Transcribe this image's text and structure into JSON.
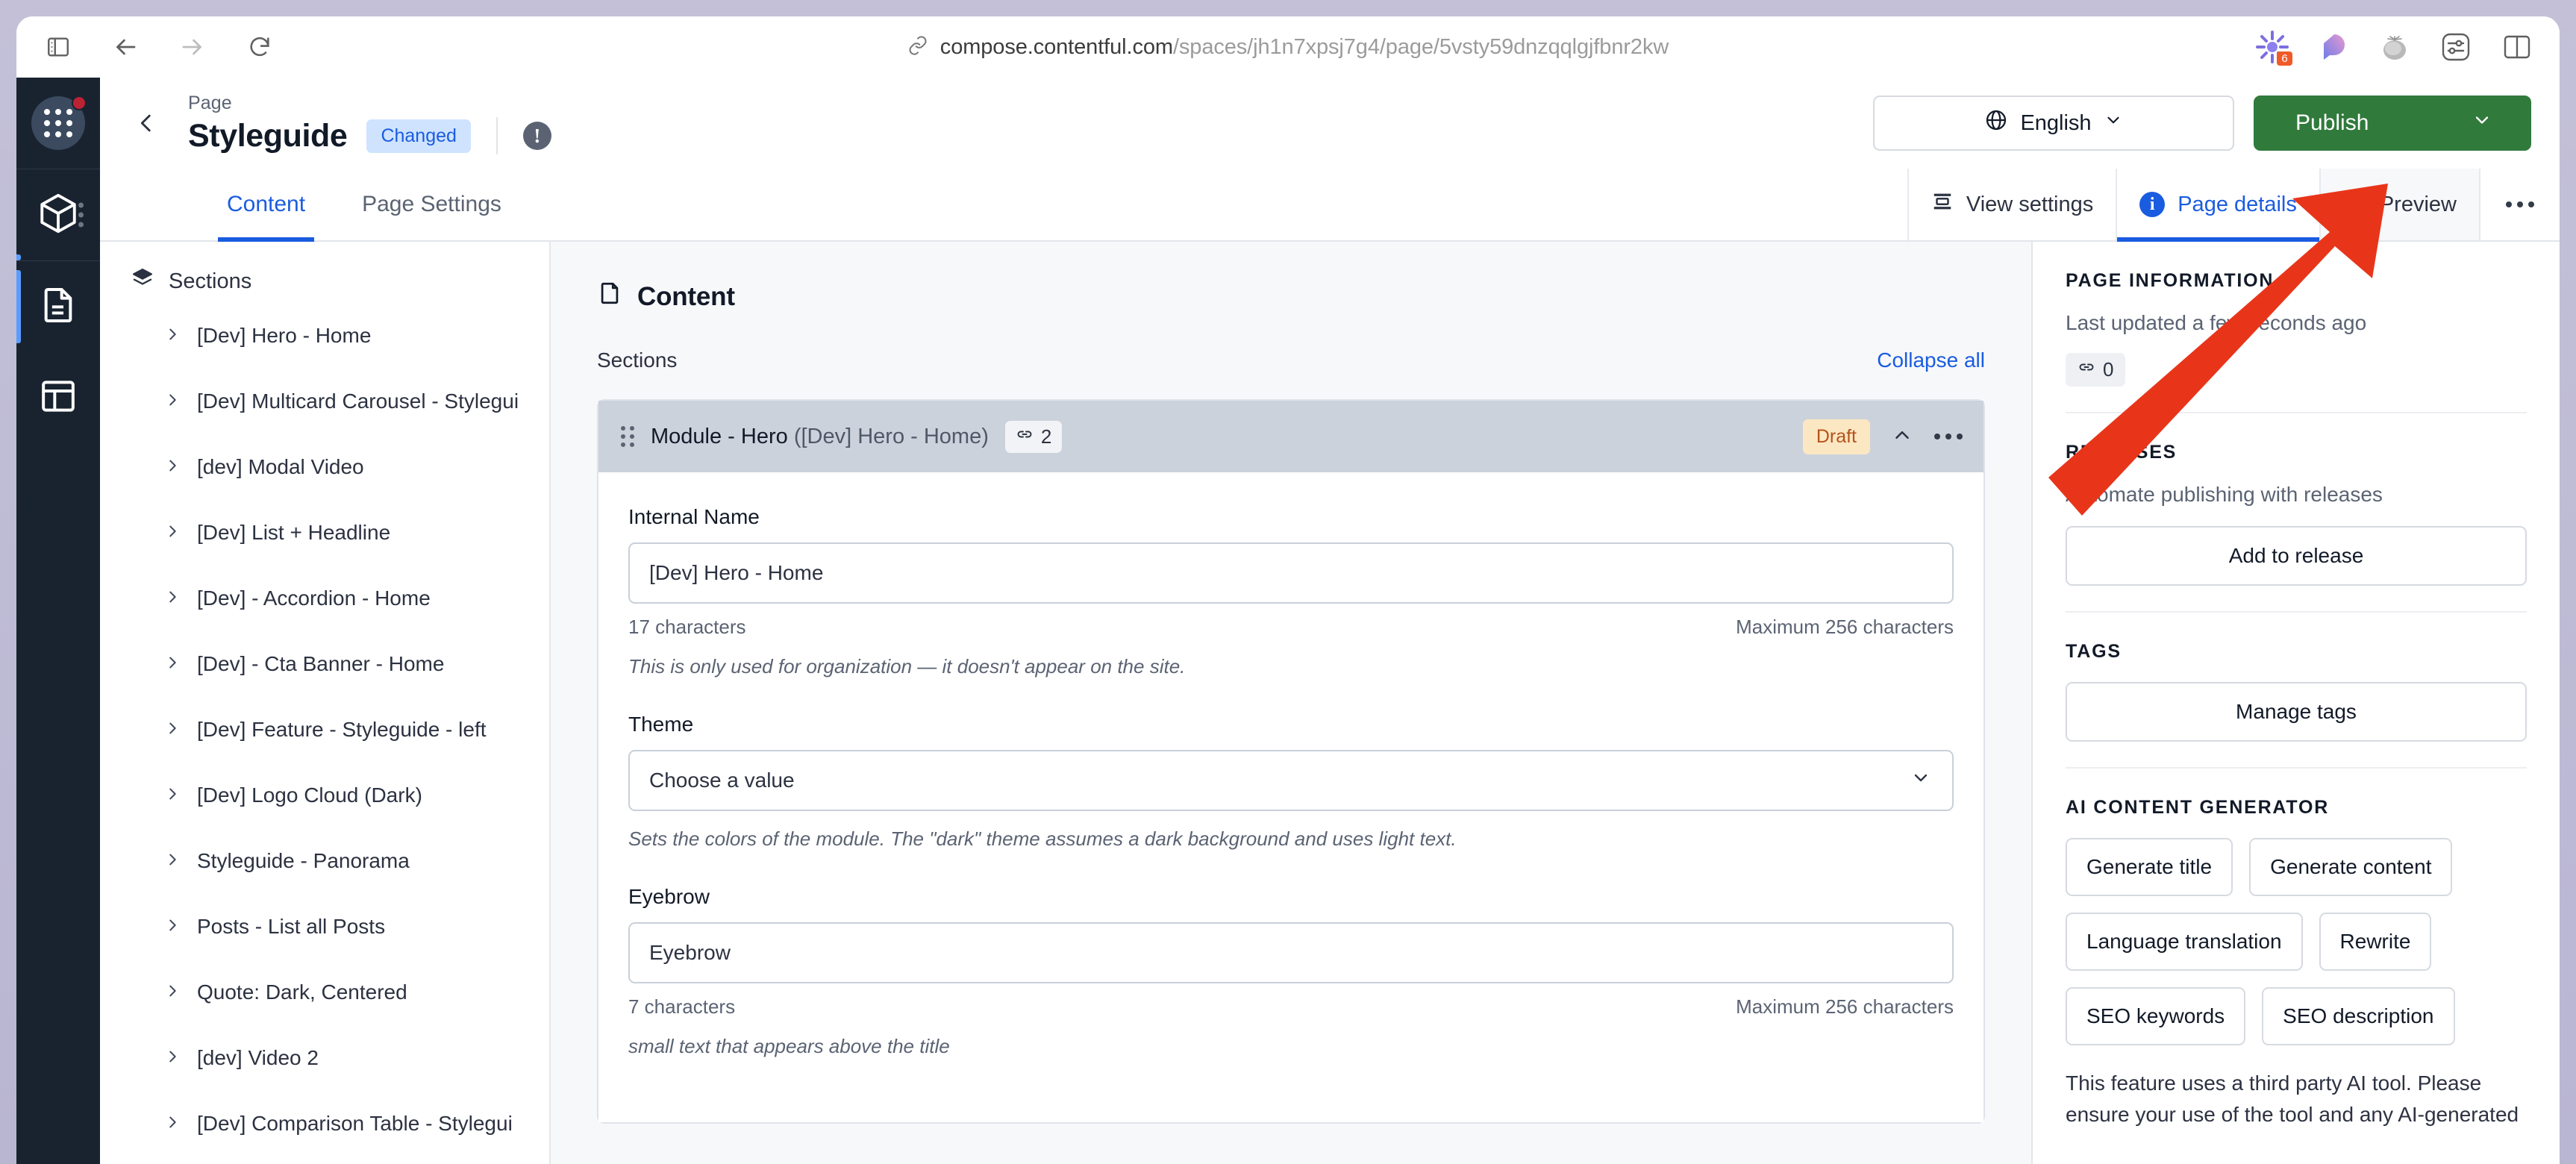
{
  "browser": {
    "url_host": "compose.contentful.com",
    "url_path": "/spaces/jh1n7xpsj7g4/page/5vsty59dnzqqlgjfbnr2kw",
    "extension_badge_count": "6"
  },
  "rail": {
    "items": [
      {
        "icon": "apps-grid-icon",
        "name": "apps-launcher"
      },
      {
        "icon": "cube-icon",
        "name": "content-model"
      },
      {
        "icon": "document-icon",
        "name": "content-entries"
      },
      {
        "icon": "layout-icon",
        "name": "pages"
      }
    ]
  },
  "header": {
    "kicker": "Page",
    "title": "Styleguide",
    "status_badge": "Changed",
    "info_glyph": "!",
    "language": "English",
    "publish_label": "Publish"
  },
  "tabs": {
    "primary": [
      {
        "label": "Content",
        "active": true
      },
      {
        "label": "Page Settings",
        "active": false
      }
    ],
    "tools": [
      {
        "label": "View settings",
        "icon": "view-settings-icon"
      },
      {
        "label": "Page details",
        "icon": "info-icon"
      },
      {
        "label": "Preview",
        "icon": "eye-icon"
      }
    ]
  },
  "left_panel": {
    "heading": "Sections",
    "items": [
      "[Dev] Hero - Home",
      "[Dev] Multicard Carousel - Stylegui",
      "[dev] Modal Video",
      "[Dev] List + Headline",
      "[Dev] - Accordion - Home",
      "[Dev] - Cta Banner - Home",
      "[Dev] Feature - Styleguide - left",
      "[Dev] Logo Cloud (Dark)",
      "Styleguide - Panorama",
      "Posts - List all Posts",
      "Quote: Dark, Centered",
      "[dev] Video 2",
      "[Dev] Comparison Table - Stylegui"
    ]
  },
  "main": {
    "content_title": "Content",
    "sections_label": "Sections",
    "collapse_all": "Collapse all",
    "module": {
      "name": "Module - Hero",
      "reference": "([Dev] Hero - Home)",
      "link_count": "2",
      "status": "Draft"
    },
    "fields": [
      {
        "label": "Internal Name",
        "value": "[Dev] Hero - Home",
        "count": "17 characters",
        "max": "Maximum 256 characters",
        "help": "This is only used for organization — it doesn't appear on the site.",
        "type": "text"
      },
      {
        "label": "Theme",
        "value": "Choose a value",
        "help": "Sets the colors of the module. The \"dark\" theme assumes a dark background and uses light text.",
        "type": "select"
      },
      {
        "label": "Eyebrow",
        "value": "Eyebrow",
        "count": "7 characters",
        "max": "Maximum 256 characters",
        "help": "small text that appears above the title",
        "type": "text"
      }
    ]
  },
  "right_panel": {
    "page_information": {
      "label": "PAGE INFORMATION",
      "last_updated": "Last updated a few seconds ago",
      "link_count": "0"
    },
    "releases": {
      "label": "RELEASES",
      "description": "Automate publishing with releases",
      "button": "Add to release"
    },
    "tags": {
      "label": "TAGS",
      "button": "Manage tags"
    },
    "ai": {
      "label": "AI CONTENT GENERATOR",
      "buttons": [
        "Generate title",
        "Generate content",
        "Language translation",
        "Rewrite",
        "SEO keywords",
        "SEO description"
      ],
      "note": "This feature uses a third party AI tool. Please ensure your use of the tool and any AI-generated"
    }
  },
  "colors": {
    "accent_blue": "#1a5ce0",
    "publish_green": "#307a3c",
    "rail_dark": "#192330",
    "draft_amber": "#fce7c3",
    "changed_blue": "#cfe3ff",
    "annotation_red": "#e8351a"
  }
}
